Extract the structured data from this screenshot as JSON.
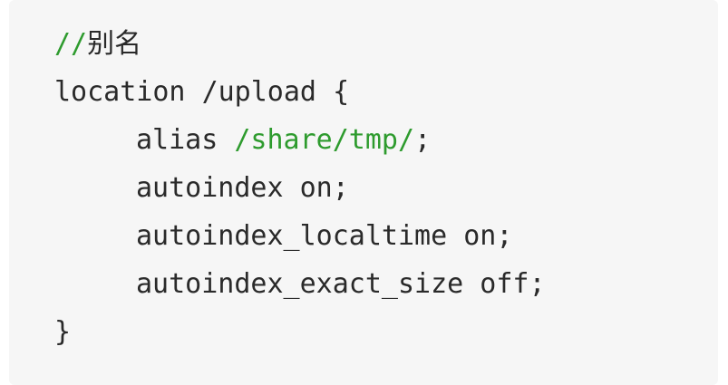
{
  "code": {
    "comment_prefix": "//",
    "comment_text": "别名",
    "location_keyword": "location",
    "location_path": "/upload",
    "open_brace": "{",
    "alias_directive": "alias",
    "alias_path": "/share/tmp/",
    "semicolon": ";",
    "autoindex_line": "autoindex on;",
    "autoindex_localtime_line": "autoindex_localtime on;",
    "autoindex_exact_size_line": "autoindex_exact_size off;",
    "close_brace": "}"
  },
  "colors": {
    "background": "#f6f6f6",
    "text": "#2a2a2a",
    "green": "#2e9b2e"
  }
}
